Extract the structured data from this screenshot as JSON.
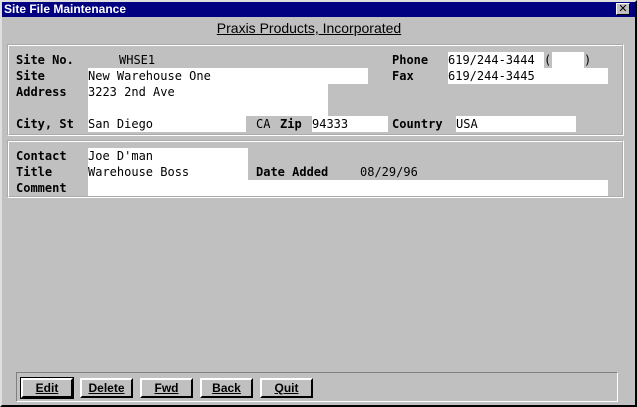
{
  "window": {
    "title": "Site File Maintenance",
    "close_glyph": "✕"
  },
  "company": "Praxis Products, Incorporated",
  "site": {
    "site_no_label": "Site No.",
    "site_no": "WHSE1",
    "site_label": "Site",
    "site": "New Warehouse One",
    "address_label": "Address",
    "address": "3223 2nd Ave",
    "city_label": "City, St",
    "city": "San Diego",
    "state": "CA",
    "zip_label": "Zip",
    "zip": "94333",
    "phone_label": "Phone",
    "phone": "619/244-3444",
    "phone_ext_open": "(",
    "phone_ext": "",
    "phone_ext_close": ")",
    "fax_label": "Fax",
    "fax": "619/244-3445",
    "country_label": "Country",
    "country": "USA"
  },
  "contact": {
    "contact_label": "Contact",
    "contact": "Joe D'man",
    "title_label": "Title",
    "title": "Warehouse Boss",
    "date_added_label": "Date Added",
    "date_added": "08/29/96",
    "comment_label": "Comment",
    "comment": ""
  },
  "buttons": {
    "edit": "Edit",
    "delete": "Delete",
    "fwd": "Fwd",
    "back": "Back",
    "quit": "Quit"
  }
}
